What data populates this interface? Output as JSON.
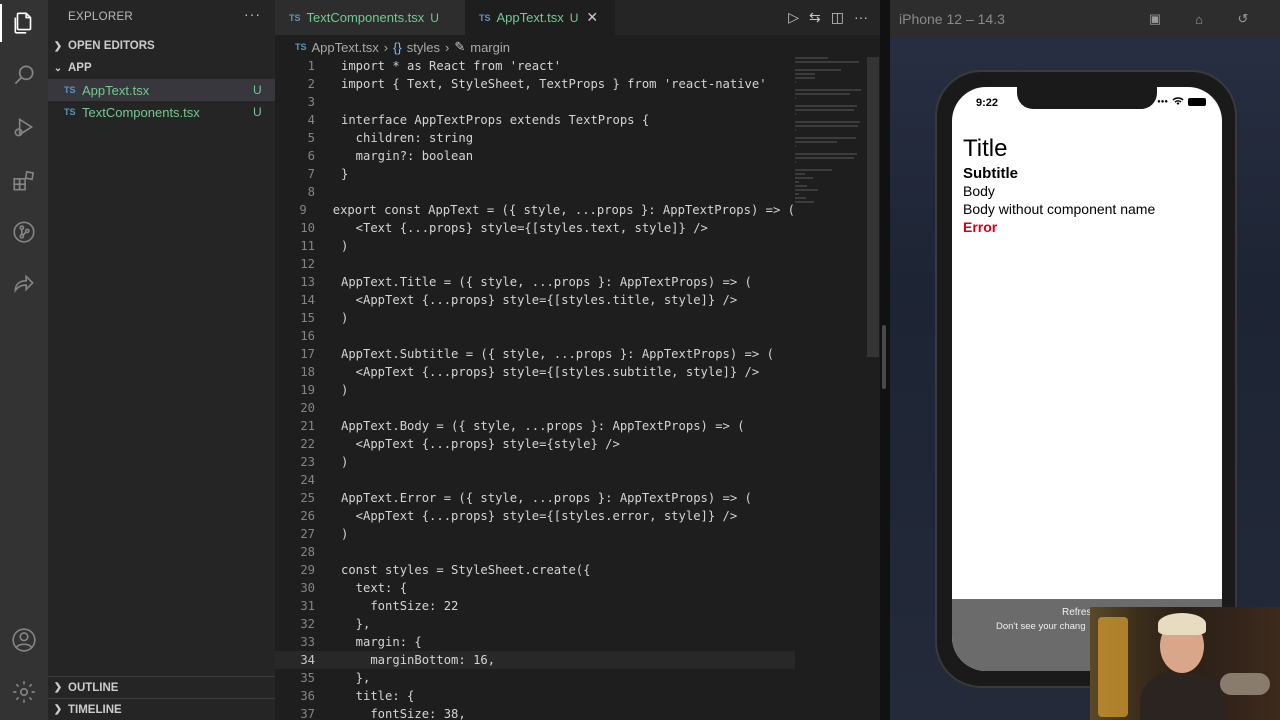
{
  "explorer": {
    "title": "EXPLORER",
    "more": "···",
    "sections": {
      "open_editors": "OPEN EDITORS",
      "app": "APP",
      "outline": "OUTLINE",
      "timeline": "TIMELINE"
    },
    "files": [
      {
        "badge": "TS",
        "name": "AppText.tsx",
        "status": "U"
      },
      {
        "badge": "TS",
        "name": "TextComponents.tsx",
        "status": "U"
      }
    ]
  },
  "tabs": [
    {
      "badge": "TS",
      "name": "TextComponents.tsx",
      "status": "U"
    },
    {
      "badge": "TS",
      "name": "AppText.tsx",
      "status": "U",
      "close": "✕"
    }
  ],
  "breadcrumb": {
    "file": "AppText.tsx",
    "badge": "TS",
    "symbol1": "styles",
    "symbol2": "margin",
    "sep": "›"
  },
  "code": {
    "current_line": 34,
    "lines": [
      "import * as React from 'react'",
      "import { Text, StyleSheet, TextProps } from 'react-native'",
      "",
      "interface AppTextProps extends TextProps {",
      "  children: string",
      "  margin?: boolean",
      "}",
      "",
      "export const AppText = ({ style, ...props }: AppTextProps) => (",
      "  <Text {...props} style={[styles.text, style]} />",
      ")",
      "",
      "AppText.Title = ({ style, ...props }: AppTextProps) => (",
      "  <AppText {...props} style={[styles.title, style]} />",
      ")",
      "",
      "AppText.Subtitle = ({ style, ...props }: AppTextProps) => (",
      "  <AppText {...props} style={[styles.subtitle, style]} />",
      ")",
      "",
      "AppText.Body = ({ style, ...props }: AppTextProps) => (",
      "  <AppText {...props} style={style} />",
      ")",
      "",
      "AppText.Error = ({ style, ...props }: AppTextProps) => (",
      "  <AppText {...props} style={[styles.error, style]} />",
      ")",
      "",
      "const styles = StyleSheet.create({",
      "  text: {",
      "    fontSize: 22",
      "  },",
      "  margin: {",
      "    marginBottom: 16,",
      "  },",
      "  title: {",
      "    fontSize: 38,"
    ]
  },
  "simulator": {
    "title": "iPhone 12 – 14.3",
    "time": "9:22",
    "app_texts": {
      "title": "Title",
      "subtitle": "Subtitle",
      "body": "Body",
      "body_plain": "Body without component name",
      "error": "Error"
    },
    "error_color": "#d0021b",
    "refresh_title": "Refres",
    "refresh_hint": "Don't see your chang"
  },
  "colors": {
    "accent_untracked": "#73c991",
    "ts_badge": "#519aba",
    "editor_bg": "#1e1e1e"
  }
}
